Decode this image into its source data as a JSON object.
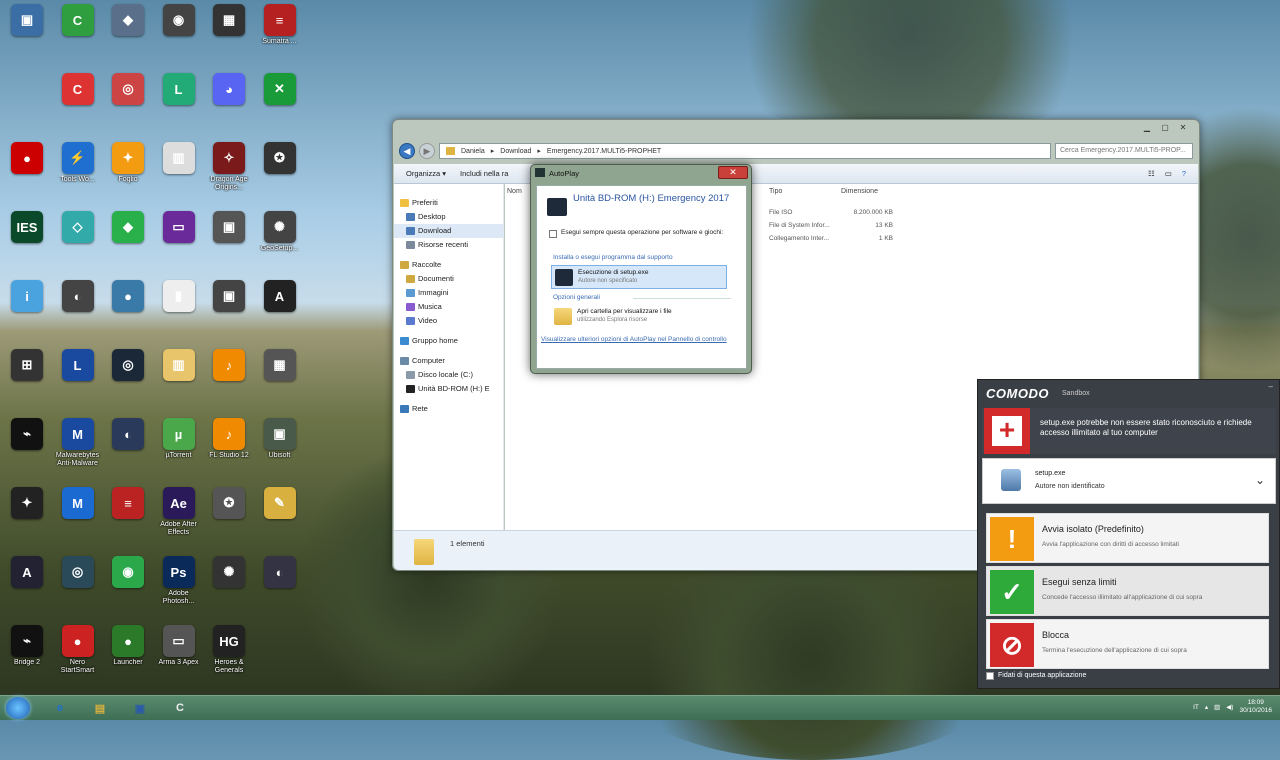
{
  "desktop": {
    "icons": [
      {
        "label": "",
        "color": "#3a6ea5",
        "glyph": "▣",
        "col": 0,
        "row": 0
      },
      {
        "label": "",
        "color": "#2f9e3e",
        "glyph": "C",
        "col": 1,
        "row": 0
      },
      {
        "label": "",
        "color": "#5a6f8a",
        "glyph": "◆",
        "col": 2,
        "row": 0
      },
      {
        "label": "",
        "color": "#444",
        "glyph": "◉",
        "col": 3,
        "row": 0
      },
      {
        "label": "",
        "color": "#333",
        "glyph": "▦",
        "col": 4,
        "row": 0
      },
      {
        "label": "Sumatra ...",
        "color": "#b52020",
        "glyph": "≡",
        "col": 5,
        "row": 0
      },
      {
        "label": "",
        "color": "#d33",
        "glyph": "C",
        "col": 1,
        "row": 1
      },
      {
        "label": "",
        "color": "#c44",
        "glyph": "◎",
        "col": 2,
        "row": 1
      },
      {
        "label": "",
        "color": "#2a7",
        "glyph": "L",
        "col": 3,
        "row": 1
      },
      {
        "label": "",
        "color": "#5865f2",
        "glyph": "◕",
        "col": 4,
        "row": 1
      },
      {
        "label": "",
        "color": "#1a9b3a",
        "glyph": "✕",
        "col": 5,
        "row": 1
      },
      {
        "label": "",
        "color": "#c00",
        "glyph": "●",
        "col": 0,
        "row": 2
      },
      {
        "label": "Tools Wo...",
        "color": "#1f6fd1",
        "glyph": "⚡",
        "col": 1,
        "row": 2
      },
      {
        "label": "Foglio",
        "color": "#f39c12",
        "glyph": "✦",
        "col": 2,
        "row": 2
      },
      {
        "label": "",
        "color": "#ddd",
        "glyph": "▥",
        "col": 3,
        "row": 2
      },
      {
        "label": "Dragon Age Origins...",
        "color": "#7a1a1a",
        "glyph": "✧",
        "col": 4,
        "row": 2
      },
      {
        "label": "",
        "color": "#333",
        "glyph": "✪",
        "col": 5,
        "row": 2
      },
      {
        "label": "",
        "color": "#0a4a2a",
        "glyph": "IES",
        "col": 0,
        "row": 3
      },
      {
        "label": "",
        "color": "#3aa",
        "glyph": "◇",
        "col": 1,
        "row": 3
      },
      {
        "label": "",
        "color": "#2ab04a",
        "glyph": "◆",
        "col": 2,
        "row": 3
      },
      {
        "label": "",
        "color": "#6a2a9a",
        "glyph": "▭",
        "col": 3,
        "row": 3
      },
      {
        "label": "",
        "color": "#555",
        "glyph": "▣",
        "col": 4,
        "row": 3
      },
      {
        "label": "GeoSetup...",
        "color": "#444",
        "glyph": "✺",
        "col": 5,
        "row": 3
      },
      {
        "label": "",
        "color": "#4aa3df",
        "glyph": "i",
        "col": 0,
        "row": 4
      },
      {
        "label": "",
        "color": "#444",
        "glyph": "◐",
        "col": 1,
        "row": 4
      },
      {
        "label": "",
        "color": "#3a7aa8",
        "glyph": "●",
        "col": 2,
        "row": 4
      },
      {
        "label": "",
        "color": "#eee",
        "glyph": "▮",
        "col": 3,
        "row": 4
      },
      {
        "label": "",
        "color": "#444",
        "glyph": "▣",
        "col": 4,
        "row": 4
      },
      {
        "label": "",
        "color": "#222",
        "glyph": "A",
        "col": 5,
        "row": 4
      },
      {
        "label": "",
        "color": "#333",
        "glyph": "⊞",
        "col": 0,
        "row": 5
      },
      {
        "label": "",
        "color": "#1a4aa0",
        "glyph": "L",
        "col": 1,
        "row": 5
      },
      {
        "label": "",
        "color": "#1b2838",
        "glyph": "◎",
        "col": 2,
        "row": 5
      },
      {
        "label": "",
        "color": "#e8c46a",
        "glyph": "▥",
        "col": 3,
        "row": 5
      },
      {
        "label": "",
        "color": "#f08a00",
        "glyph": "♪",
        "col": 4,
        "row": 5
      },
      {
        "label": "",
        "color": "#555",
        "glyph": "▦",
        "col": 5,
        "row": 5
      },
      {
        "label": "",
        "color": "#111",
        "glyph": "⌁",
        "col": 0,
        "row": 6
      },
      {
        "label": "Malwarebytes Anti-Malware",
        "color": "#1a4aa0",
        "glyph": "M",
        "col": 1,
        "row": 6
      },
      {
        "label": "",
        "color": "#2a3a5a",
        "glyph": "◐",
        "col": 2,
        "row": 6
      },
      {
        "label": "µTorrent",
        "color": "#4aa84a",
        "glyph": "µ",
        "col": 3,
        "row": 6
      },
      {
        "label": "FL Studio 12",
        "color": "#f08a00",
        "glyph": "♪",
        "col": 4,
        "row": 6
      },
      {
        "label": "Ubisoft",
        "color": "#4a5a4a",
        "glyph": "▣",
        "col": 5,
        "row": 6
      },
      {
        "label": "",
        "color": "#222",
        "glyph": "✦",
        "col": 0,
        "row": 7
      },
      {
        "label": "",
        "color": "#1a6ad1",
        "glyph": "M",
        "col": 1,
        "row": 7
      },
      {
        "label": "",
        "color": "#b22",
        "glyph": "≡",
        "col": 2,
        "row": 7
      },
      {
        "label": "Adobe After Effects",
        "color": "#2a1a5a",
        "glyph": "Ae",
        "col": 3,
        "row": 7
      },
      {
        "label": "",
        "color": "#555",
        "glyph": "✪",
        "col": 4,
        "row": 7
      },
      {
        "label": "",
        "color": "#d8b040",
        "glyph": "✎",
        "col": 5,
        "row": 7
      },
      {
        "label": "",
        "color": "#223",
        "glyph": "A",
        "col": 0,
        "row": 8
      },
      {
        "label": "",
        "color": "#2a4a5a",
        "glyph": "◎",
        "col": 1,
        "row": 8
      },
      {
        "label": "",
        "color": "#2aa84a",
        "glyph": "◉",
        "col": 2,
        "row": 8
      },
      {
        "label": "Adobe Photosh...",
        "color": "#0a2a5a",
        "glyph": "Ps",
        "col": 3,
        "row": 8
      },
      {
        "label": "",
        "color": "#333",
        "glyph": "✺",
        "col": 4,
        "row": 8
      },
      {
        "label": "",
        "color": "#334",
        "glyph": "◐",
        "col": 5,
        "row": 8
      },
      {
        "label": "Bridge 2",
        "color": "#111",
        "glyph": "⌁",
        "col": 0,
        "row": 9
      },
      {
        "label": "Nero StartSmart",
        "color": "#c22",
        "glyph": "●",
        "col": 1,
        "row": 9
      },
      {
        "label": "Launcher",
        "color": "#2a7a2a",
        "glyph": "●",
        "col": 2,
        "row": 9
      },
      {
        "label": "Arma 3 Apex",
        "color": "#555",
        "glyph": "▭",
        "col": 3,
        "row": 9
      },
      {
        "label": "Heroes & Generals",
        "color": "#222",
        "glyph": "HG",
        "col": 4,
        "row": 9
      }
    ]
  },
  "explorer": {
    "breadcrumb": [
      "Daniela",
      "Download",
      "Emergency.2017.MULTi5-PROPHET"
    ],
    "search_placeholder": "Cerca Emergency.2017.MULTi5-PROP...",
    "toolbar": {
      "organize": "Organizza ▾",
      "include": "Includi nella ra"
    },
    "nav": [
      {
        "label": "Preferiti",
        "group": true,
        "color": "#f0c040"
      },
      {
        "label": "Desktop",
        "group": false,
        "color": "#4a7ab8"
      },
      {
        "label": "Download",
        "group": false,
        "color": "#4a7ab8",
        "selected": true
      },
      {
        "label": "Risorse recenti",
        "group": false,
        "color": "#7a8a9a"
      },
      {
        "label": "Raccolte",
        "group": true,
        "color": "#d0a840"
      },
      {
        "label": "Documenti",
        "group": false,
        "color": "#d0a840"
      },
      {
        "label": "Immagini",
        "group": false,
        "color": "#5a9ad0"
      },
      {
        "label": "Musica",
        "group": false,
        "color": "#8a5ad0"
      },
      {
        "label": "Video",
        "group": false,
        "color": "#5a7ad0"
      },
      {
        "label": "Gruppo home",
        "group": true,
        "color": "#3a8ad0"
      },
      {
        "label": "Computer",
        "group": true,
        "color": "#6a8aa8"
      },
      {
        "label": "Disco locale (C:)",
        "group": false,
        "color": "#8a9aa8"
      },
      {
        "label": "Unità BD-ROM (H:) E",
        "group": false,
        "color": "#222"
      },
      {
        "label": "Rete",
        "group": true,
        "color": "#3a7ab8"
      }
    ],
    "columns": {
      "name": "Nom",
      "type": "Tipo",
      "size": "Dimensione"
    },
    "rows": [
      {
        "type": "File ISO",
        "size": "8.200.000 KB"
      },
      {
        "type": "File di System Infor...",
        "size": "13 KB"
      },
      {
        "type": "Collegamento Inter...",
        "size": "1 KB"
      }
    ],
    "status": "1 elementi"
  },
  "autoplay": {
    "title": "AutoPlay",
    "close": "✕",
    "drive_name": "Unità BD-ROM (H:) Emergency 2017",
    "always_check": "Esegui sempre questa operazione per software e giochi:",
    "section_install": "Installa o esegui programma dal supporto",
    "option_run": "Esecuzione di setup.exe",
    "option_run_sub": "Autore non specificato",
    "section_general": "Opzioni generali",
    "option_open": "Apri cartella per visualizzare i file",
    "option_open_sub": "utilizzando Esplora risorse",
    "link": "Visualizzare ulteriori opzioni di AutoPlay nel Pannello di controllo"
  },
  "comodo": {
    "logo": "COMODO",
    "subtitle": "Sandbox",
    "minimize": "–",
    "message": "setup.exe potrebbe non essere stato riconosciuto e richiede accesso illimitato al tuo computer",
    "app_name": "setup.exe",
    "publisher": "Autore non identificato",
    "actions": [
      {
        "title": "Avvia isolato (Predefinito)",
        "desc": "Avvia l'applicazione con diritti di accesso limitati",
        "color": "#f39c12",
        "glyph": "!"
      },
      {
        "title": "Esegui senza limiti",
        "desc": "Concede l'accesso illimitato all'applicazione di cui sopra",
        "color": "#2eaa3a",
        "glyph": "✓"
      },
      {
        "title": "Blocca",
        "desc": "Termina l'esecuzione dell'applicazione di cui sopra",
        "color": "#d22a2a",
        "glyph": "⊘"
      }
    ],
    "trust": "Fidati di questa applicazione"
  },
  "taskbar": {
    "apps": [
      {
        "glyph": "e",
        "color": "#1f6fd1"
      },
      {
        "glyph": "▤",
        "color": "#d8b040"
      },
      {
        "glyph": "▣",
        "color": "#2a5aa8"
      },
      {
        "glyph": "C",
        "color": "#eee"
      }
    ],
    "lang": "IT",
    "time": "18:09",
    "date": "30/10/2016"
  }
}
